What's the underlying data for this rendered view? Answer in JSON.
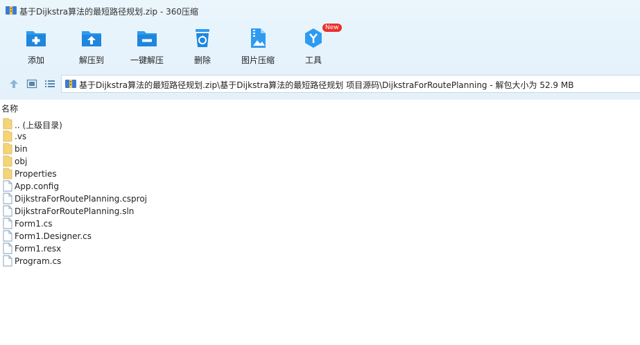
{
  "window": {
    "title": "基于Dijkstra算法的最短路径规划.zip - 360压缩",
    "icon": "archive-icon"
  },
  "toolbar": {
    "items": [
      {
        "label": "添加",
        "icon": "folder-add-icon"
      },
      {
        "label": "解压到",
        "icon": "folder-extract-icon"
      },
      {
        "label": "一键解压",
        "icon": "folder-oneclick-icon"
      },
      {
        "label": "删除",
        "icon": "recycle-bin-icon"
      },
      {
        "label": "图片压缩",
        "icon": "zip-image-icon"
      },
      {
        "label": "工具",
        "icon": "tools-icon",
        "badge": "New"
      }
    ],
    "accent_color": "#2f9bf0"
  },
  "nav": {
    "buttons": [
      "up-arrow-icon",
      "thumbnail-view-icon",
      "list-view-icon"
    ],
    "address": "基于Dijkstra算法的最短路径规划.zip\\基于Dijkstra算法的最短路径规划 项目源码\\DijkstraForRoutePlanning - 解包大小为 52.9 MB"
  },
  "columns": {
    "name": "名称"
  },
  "files": [
    {
      "name": ".. (上级目录)",
      "type": "folder"
    },
    {
      "name": ".vs",
      "type": "folder"
    },
    {
      "name": "bin",
      "type": "folder"
    },
    {
      "name": "obj",
      "type": "folder"
    },
    {
      "name": "Properties",
      "type": "folder"
    },
    {
      "name": "App.config",
      "type": "file"
    },
    {
      "name": "DijkstraForRoutePlanning.csproj",
      "type": "file"
    },
    {
      "name": "DijkstraForRoutePlanning.sln",
      "type": "file"
    },
    {
      "name": "Form1.cs",
      "type": "file"
    },
    {
      "name": "Form1.Designer.cs",
      "type": "file"
    },
    {
      "name": "Form1.resx",
      "type": "file"
    },
    {
      "name": "Program.cs",
      "type": "file"
    }
  ]
}
